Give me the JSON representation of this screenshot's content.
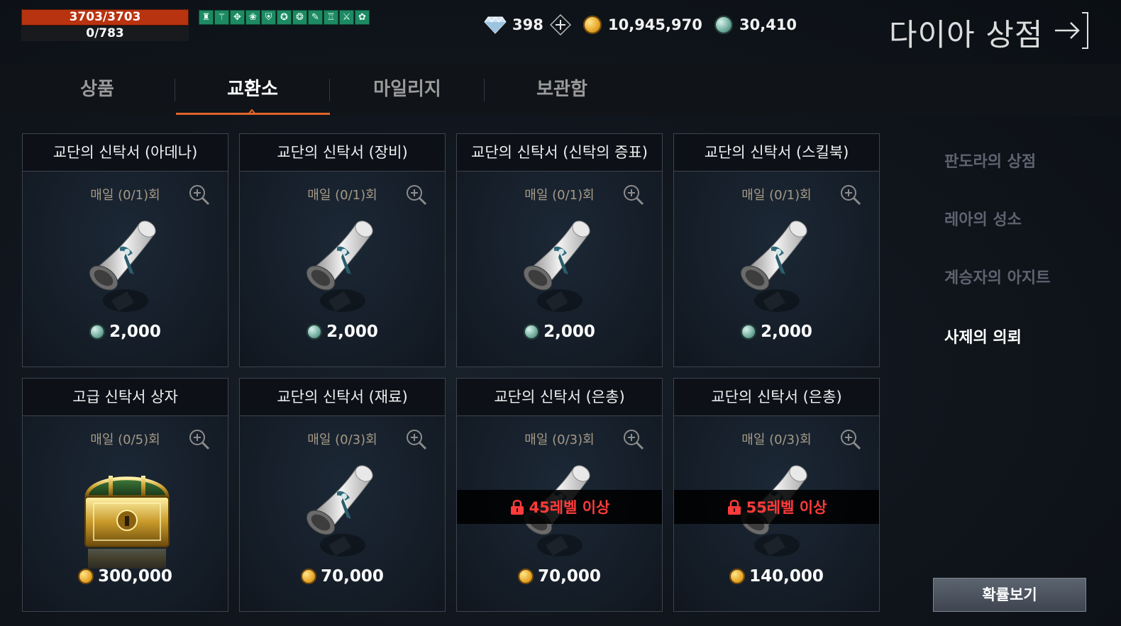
{
  "status": {
    "hp": "3703/3703",
    "mp": "0/783"
  },
  "buffs": [
    "♜",
    "⚚",
    "✥",
    "❀",
    "⛨",
    "✪",
    "❂",
    "✎",
    "♖",
    "⚔",
    "✿",
    "❖"
  ],
  "currency": {
    "diamond": "398",
    "gold": "10,945,970",
    "silver": "30,410"
  },
  "page_title": "다이아 상점",
  "tabs": [
    {
      "label": "상품"
    },
    {
      "label": "교환소",
      "active": true
    },
    {
      "label": "마일리지"
    },
    {
      "label": "보관함"
    }
  ],
  "cards": [
    {
      "title": "교단의 신탁서 (아데나)",
      "limit": "매일 (0/1)회",
      "price": "2,000",
      "currency": "silver",
      "item": "scroll"
    },
    {
      "title": "교단의 신탁서 (장비)",
      "limit": "매일 (0/1)회",
      "price": "2,000",
      "currency": "silver",
      "item": "scroll"
    },
    {
      "title": "교단의 신탁서 (신탁의 증표)",
      "limit": "매일 (0/1)회",
      "price": "2,000",
      "currency": "silver",
      "item": "scroll"
    },
    {
      "title": "교단의 신탁서 (스킬북)",
      "limit": "매일 (0/1)회",
      "price": "2,000",
      "currency": "silver",
      "item": "scroll"
    },
    {
      "title": "고급 신탁서 상자",
      "limit": "매일 (0/5)회",
      "price": "300,000",
      "currency": "gold",
      "item": "chest"
    },
    {
      "title": "교단의 신탁서 (재료)",
      "limit": "매일 (0/3)회",
      "price": "70,000",
      "currency": "gold",
      "item": "scroll"
    },
    {
      "title": "교단의 신탁서 (은총)",
      "limit": "매일 (0/3)회",
      "price": "70,000",
      "currency": "gold",
      "item": "scroll",
      "lock": "45레벨 이상"
    },
    {
      "title": "교단의 신탁서 (은총)",
      "limit": "매일 (0/3)회",
      "price": "140,000",
      "currency": "gold",
      "item": "scroll",
      "lock": "55레벨 이상"
    }
  ],
  "side_menu": [
    {
      "label": "판도라의 상점"
    },
    {
      "label": "레아의 성소"
    },
    {
      "label": "계승자의 아지트"
    },
    {
      "label": "사제의 의뢰",
      "active": true
    }
  ],
  "probability_button": "확률보기",
  "colors": {
    "hp": "#b8330f",
    "buff": "#1d8a63",
    "accent": "#e0642a",
    "lock": "#ff3b3b"
  }
}
